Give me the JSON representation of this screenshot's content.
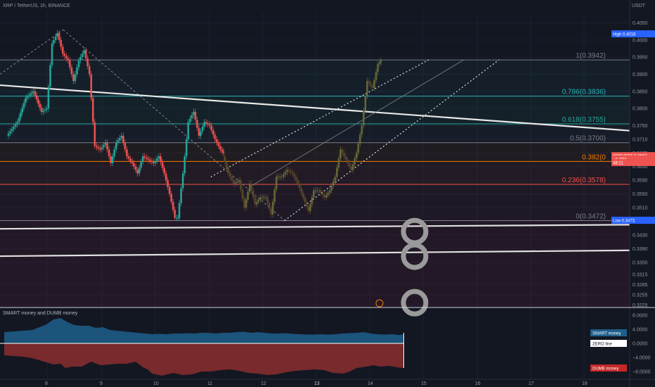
{
  "header": {
    "symbol_line": "XRP / TetherUS, 1h, BINANCE",
    "currency": "USDT"
  },
  "chart_data": [
    {
      "type": "candlestick",
      "title": "XRP / TetherUS, 1h, BINANCE",
      "ylabel": "USDT",
      "ylim": [
        0.322,
        0.408
      ],
      "x_ticks": [
        "8",
        "9",
        "10",
        "11",
        "12",
        "13",
        "14",
        "15",
        "16",
        "17",
        "18"
      ],
      "y_ticks": [
        "0.4050",
        "0.4000",
        "0.3950",
        "0.3900",
        "0.3850",
        "0.3800",
        "0.3750",
        "0.3710",
        "0.3670",
        "0.3630",
        "0.3590",
        "0.3550",
        "0.3510",
        "0.3470",
        "0.3430",
        "0.3390",
        "0.3350",
        "0.3315",
        "0.3285",
        "0.3255",
        "0.3225"
      ],
      "price_path": [
        [
          0,
          0.372
        ],
        [
          4,
          0.376
        ],
        [
          7,
          0.383
        ],
        [
          10,
          0.385
        ],
        [
          13,
          0.379
        ],
        [
          15,
          0.38
        ],
        [
          17,
          0.399
        ],
        [
          19,
          0.402
        ],
        [
          21,
          0.396
        ],
        [
          23,
          0.394
        ],
        [
          25,
          0.388
        ],
        [
          27,
          0.394
        ],
        [
          29,
          0.397
        ],
        [
          31,
          0.39
        ],
        [
          33,
          0.369
        ],
        [
          35,
          0.368
        ],
        [
          37,
          0.37
        ],
        [
          39,
          0.364
        ],
        [
          41,
          0.37
        ],
        [
          43,
          0.372
        ],
        [
          45,
          0.366
        ],
        [
          47,
          0.364
        ],
        [
          49,
          0.361
        ],
        [
          51,
          0.366
        ],
        [
          53,
          0.365
        ],
        [
          55,
          0.364
        ],
        [
          57,
          0.366
        ],
        [
          59,
          0.361
        ],
        [
          61,
          0.355
        ],
        [
          63,
          0.348
        ],
        [
          64,
          0.348
        ],
        [
          66,
          0.361
        ],
        [
          68,
          0.376
        ],
        [
          70,
          0.379
        ],
        [
          72,
          0.372
        ],
        [
          74,
          0.376
        ],
        [
          76,
          0.375
        ],
        [
          78,
          0.371
        ],
        [
          80,
          0.368
        ],
        [
          81,
          0.367
        ]
      ],
      "ghost_path": [
        [
          81,
          0.366
        ],
        [
          83,
          0.361
        ],
        [
          85,
          0.358
        ],
        [
          87,
          0.359
        ],
        [
          89,
          0.351
        ],
        [
          91,
          0.358
        ],
        [
          93,
          0.352
        ],
        [
          95,
          0.354
        ],
        [
          97,
          0.354
        ],
        [
          99,
          0.349
        ],
        [
          101,
          0.36
        ],
        [
          103,
          0.36
        ],
        [
          105,
          0.362
        ],
        [
          107,
          0.361
        ],
        [
          109,
          0.358
        ],
        [
          111,
          0.354
        ],
        [
          113,
          0.35
        ],
        [
          115,
          0.356
        ],
        [
          117,
          0.356
        ],
        [
          119,
          0.354
        ],
        [
          121,
          0.356
        ],
        [
          123,
          0.36
        ],
        [
          125,
          0.368
        ],
        [
          127,
          0.365
        ],
        [
          129,
          0.362
        ],
        [
          131,
          0.367
        ],
        [
          133,
          0.375
        ],
        [
          135,
          0.388
        ],
        [
          137,
          0.386
        ],
        [
          139,
          0.393
        ],
        [
          140,
          0.394
        ]
      ],
      "overlays": {
        "fib_levels": [
          {
            "ratio_label": "1(0.3942)",
            "price": 0.3942,
            "color": "#787b86"
          },
          {
            "ratio_label": "0.786(0.3836)",
            "price": 0.3836,
            "color": "#2bb5bc"
          },
          {
            "ratio_label": "0.618(0.3755)",
            "price": 0.3755,
            "color": "#26a69a"
          },
          {
            "ratio_label": "0.5(0.3700)",
            "price": 0.37,
            "color": "#787b86"
          },
          {
            "ratio_label": "0.382(0",
            "price": 0.3645,
            "color": "#f57c00"
          },
          {
            "ratio_label": "0.236(0.3578)",
            "price": 0.3578,
            "color": "#ef5350"
          },
          {
            "ratio_label": "0(0.3472)",
            "price": 0.3472,
            "color": "#787b86"
          }
        ],
        "badges": [
          {
            "text": "High 0.4018",
            "price": 0.4018,
            "bg": "#2962ff",
            "color": "#ffffff"
          },
          {
            "text": "XRPUSDT 0.3662",
            "price": 0.3662,
            "bg": "#ef5350",
            "color": "#ffffff"
          },
          {
            "text": "−0.79%",
            "price": 0.3652,
            "bg": "#ef5350",
            "color": "#ffffff"
          },
          {
            "text": "48:21",
            "price": 0.3642,
            "bg": "#ef5350",
            "color": "#ffffff"
          },
          {
            "text": "Low 0.3473",
            "price": 0.3473,
            "bg": "#2962ff",
            "color": "#ffffff"
          }
        ]
      }
    },
    {
      "type": "area",
      "title": "SMART money and DUMB money",
      "series": [
        {
          "name": "SMART money",
          "color": "#1f5f8b"
        },
        {
          "name": "ZERO line",
          "color": "#ffffff"
        },
        {
          "name": "DUMB money",
          "color": "#8b2e2e"
        }
      ],
      "y_ticks": [
        "8.0000",
        "4.0000",
        "0.0000",
        "−4.0000",
        "−8.0000"
      ],
      "smart_values": [
        [
          0,
          3.2
        ],
        [
          8,
          3.4
        ],
        [
          16,
          3.6
        ],
        [
          24,
          3.8
        ],
        [
          30,
          4.6
        ],
        [
          36,
          5.4
        ],
        [
          42,
          6.8
        ],
        [
          48,
          7.2
        ],
        [
          54,
          6.0
        ],
        [
          60,
          5.2
        ],
        [
          66,
          5.0
        ],
        [
          72,
          5.0
        ],
        [
          78,
          4.4
        ],
        [
          84,
          4.6
        ],
        [
          90,
          3.8
        ],
        [
          96,
          3.6
        ],
        [
          102,
          3.4
        ],
        [
          108,
          3.2
        ],
        [
          114,
          3.0
        ],
        [
          120,
          2.8
        ],
        [
          126,
          2.6
        ],
        [
          132,
          2.7
        ],
        [
          138,
          2.6
        ],
        [
          144,
          2.8
        ],
        [
          150,
          2.8
        ],
        [
          156,
          2.9
        ],
        [
          162,
          2.8
        ],
        [
          168,
          3.0
        ],
        [
          174,
          3.0
        ],
        [
          180,
          2.8
        ],
        [
          186,
          3.0
        ],
        [
          192,
          3.0
        ],
        [
          198,
          3.2
        ],
        [
          204,
          3.3
        ],
        [
          210,
          3.0
        ],
        [
          216,
          3.2
        ],
        [
          222,
          3.0
        ],
        [
          228,
          2.8
        ],
        [
          234,
          2.8
        ],
        [
          240,
          2.9
        ],
        [
          246,
          2.7
        ],
        [
          252,
          2.6
        ],
        [
          258,
          2.5
        ],
        [
          264,
          2.5
        ],
        [
          270,
          2.6
        ],
        [
          276,
          2.5
        ],
        [
          282,
          2.6
        ],
        [
          288,
          2.8
        ],
        [
          294,
          2.9
        ],
        [
          300,
          3.0
        ],
        [
          306,
          3.2
        ],
        [
          312,
          2.8
        ],
        [
          318,
          2.6
        ],
        [
          324,
          2.5
        ],
        [
          330,
          2.6
        ],
        [
          336,
          2.4
        ],
        [
          340,
          2.5
        ]
      ],
      "dumb_values": [
        [
          0,
          -3.4
        ],
        [
          8,
          -3.6
        ],
        [
          16,
          -3.8
        ],
        [
          24,
          -4.2
        ],
        [
          30,
          -4.8
        ],
        [
          36,
          -5.4
        ],
        [
          42,
          -6.0
        ],
        [
          48,
          -5.8
        ],
        [
          52,
          -7.0
        ],
        [
          58,
          -6.6
        ],
        [
          66,
          -6.6
        ],
        [
          74,
          -5.2
        ],
        [
          82,
          -6.2
        ],
        [
          90,
          -6.0
        ],
        [
          96,
          -5.8
        ],
        [
          104,
          -5.8
        ],
        [
          112,
          -5.2
        ],
        [
          118,
          -6.8
        ],
        [
          122,
          -7.4
        ],
        [
          126,
          -8.6
        ],
        [
          134,
          -9.2
        ],
        [
          144,
          -8.4
        ],
        [
          152,
          -9.0
        ],
        [
          160,
          -8.8
        ],
        [
          168,
          -8.0
        ],
        [
          176,
          -8.0
        ],
        [
          184,
          -7.6
        ],
        [
          192,
          -7.4
        ],
        [
          200,
          -7.8
        ],
        [
          208,
          -8.4
        ],
        [
          216,
          -8.6
        ],
        [
          224,
          -9.0
        ],
        [
          232,
          -8.8
        ],
        [
          240,
          -8.2
        ],
        [
          248,
          -7.8
        ],
        [
          256,
          -7.6
        ],
        [
          264,
          -7.4
        ],
        [
          272,
          -7.6
        ],
        [
          280,
          -8.4
        ],
        [
          288,
          -8.6
        ],
        [
          294,
          -8.0
        ],
        [
          300,
          -7.0
        ],
        [
          308,
          -6.6
        ],
        [
          314,
          -6.2
        ],
        [
          320,
          -6.6
        ],
        [
          328,
          -6.4
        ],
        [
          334,
          -6.8
        ],
        [
          340,
          -7.0
        ]
      ],
      "badges": [
        {
          "text": "SMART money",
          "value": 3.0,
          "bg": "#1f5f8b",
          "color": "#ffffff"
        },
        {
          "text": "ZERO line",
          "value": 0.0,
          "bg": "#ffffff",
          "color": "#131722"
        },
        {
          "text": "DUMB money",
          "value": -7.0,
          "bg": "#c62828",
          "color": "#ffffff"
        }
      ]
    }
  ]
}
